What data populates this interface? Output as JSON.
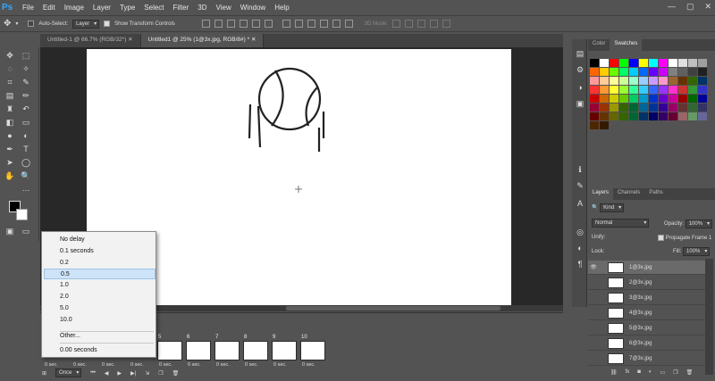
{
  "app": {
    "logo": "Ps"
  },
  "menu": [
    "File",
    "Edit",
    "Image",
    "Layer",
    "Type",
    "Select",
    "Filter",
    "3D",
    "View",
    "Window",
    "Help"
  ],
  "options": {
    "auto_select_label": "Auto-Select:",
    "auto_select_value": "Layer",
    "show_transform_label": "Show Transform Controls",
    "mode_3d": "3D Mode:"
  },
  "tabs": [
    {
      "label": "Untitled-1 @ 66.7% (RGB/32*)"
    },
    {
      "label": "Untitled1 @ 25% (1@3x.jpg, RGB/8#) *"
    }
  ],
  "delay_menu": {
    "items": [
      "No delay",
      "0.1 seconds",
      "0.2",
      "0.5",
      "1.0",
      "2.0",
      "5.0",
      "10.0"
    ],
    "selected": "0.5",
    "other": "Other...",
    "current": "0.00 seconds"
  },
  "timeline": {
    "frames": [
      {
        "num": "5",
        "delay": "0 sec."
      },
      {
        "num": "6",
        "delay": "0 sec."
      },
      {
        "num": "7",
        "delay": "0 sec."
      },
      {
        "num": "8",
        "delay": "0 sec."
      },
      {
        "num": "9",
        "delay": "0 sec."
      },
      {
        "num": "10",
        "delay": "0 sec."
      }
    ],
    "hidden_delays": [
      "0 sec.",
      "0 sec.",
      "0 sec.",
      "0 sec."
    ],
    "loop": "Once"
  },
  "panels": {
    "top_tabs": [
      "Color",
      "Swatches"
    ],
    "bottom_tabs": [
      "Layers",
      "Channels",
      "Paths"
    ],
    "kind": "Kind",
    "blend": "Normal",
    "opacity_label": "Opacity:",
    "opacity": "100%",
    "unify": "Unify:",
    "propagate": "Propagate Frame 1",
    "lock": "Lock:",
    "fill_label": "Fill:",
    "fill": "100%"
  },
  "swatches": [
    "#000000",
    "#ffffff",
    "#ff0000",
    "#00ff00",
    "#0000ff",
    "#ffff00",
    "#00ffff",
    "#ff00ff",
    "#ffffff",
    "#e0e0e0",
    "#c0c0c0",
    "#a0a0a0",
    "#ff6600",
    "#ffcc00",
    "#66ff00",
    "#00ff66",
    "#00ccff",
    "#0066ff",
    "#6600ff",
    "#cc00ff",
    "#808080",
    "#606060",
    "#404040",
    "#202020",
    "#ff9999",
    "#ffcc99",
    "#ffff99",
    "#ccff99",
    "#99ffcc",
    "#99ccff",
    "#cc99ff",
    "#ff99cc",
    "#996633",
    "#663300",
    "#336600",
    "#003366",
    "#ff3333",
    "#ff9933",
    "#ffff33",
    "#99ff33",
    "#33ff99",
    "#33ccff",
    "#3366ff",
    "#9933ff",
    "#ff33cc",
    "#cc3333",
    "#339933",
    "#3333cc",
    "#cc0000",
    "#cc6600",
    "#cccc00",
    "#66cc00",
    "#00cc66",
    "#0099cc",
    "#0033cc",
    "#6600cc",
    "#cc0099",
    "#990000",
    "#006600",
    "#000099",
    "#990033",
    "#993300",
    "#999900",
    "#336600",
    "#006633",
    "#006699",
    "#003399",
    "#330099",
    "#990066",
    "#663333",
    "#336633",
    "#333366",
    "#660000",
    "#663300",
    "#666600",
    "#336600",
    "#006633",
    "#003366",
    "#000066",
    "#330066",
    "#660033",
    "#996666",
    "#669966",
    "#666699",
    "#4d2600",
    "#331a00"
  ],
  "layers": [
    {
      "name": "1@3x.jpg",
      "active": true
    },
    {
      "name": "2@3x.jpg",
      "active": false
    },
    {
      "name": "3@3x.jpg",
      "active": false
    },
    {
      "name": "4@3x.jpg",
      "active": false
    },
    {
      "name": "5@3x.jpg",
      "active": false
    },
    {
      "name": "6@3x.jpg",
      "active": false
    },
    {
      "name": "7@3x.jpg",
      "active": false
    }
  ]
}
